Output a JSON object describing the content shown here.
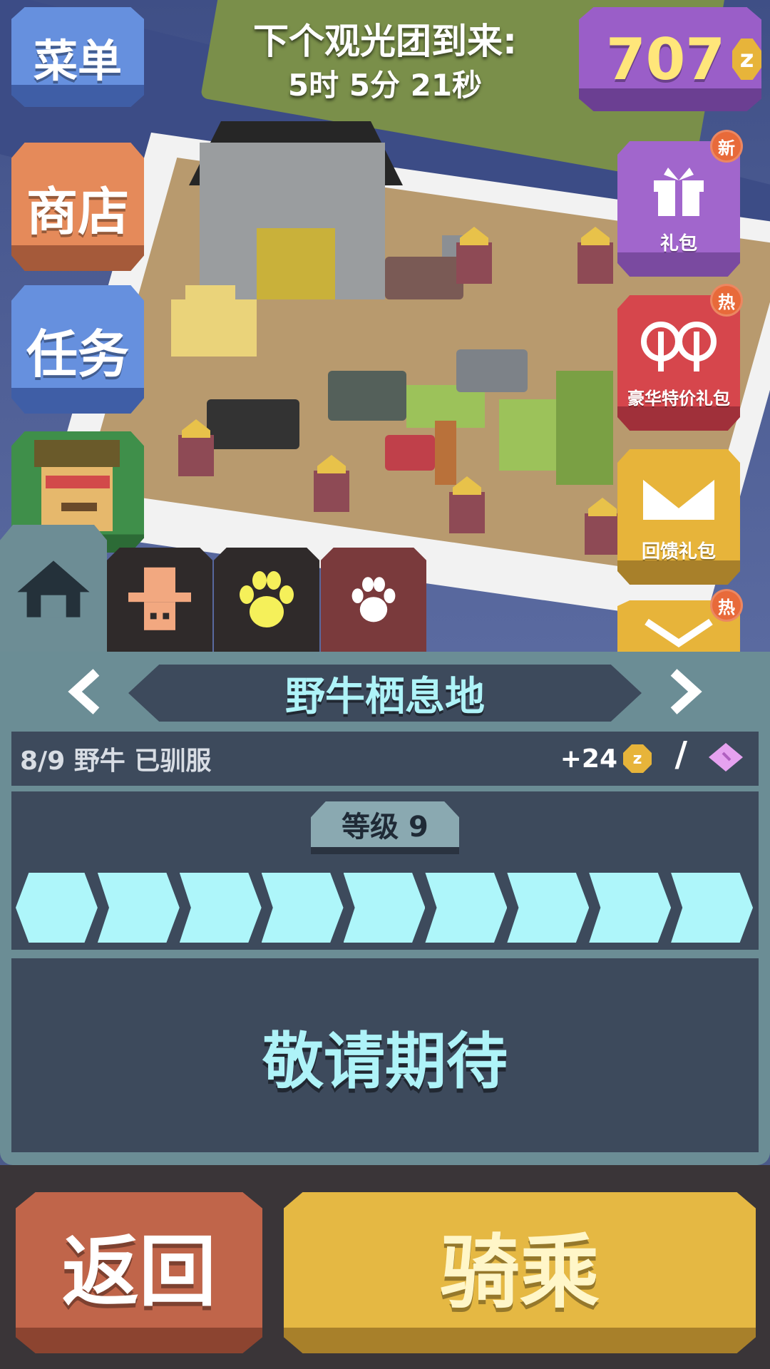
{
  "hud": {
    "menu_label": "菜单",
    "shop_label": "商店",
    "task_label": "任务",
    "next_tour_title": "下个观光团到来:",
    "next_tour_time": "5时 5分 21秒",
    "coins": "707",
    "coin_icon": "coin-icon",
    "coin_symbol": "z"
  },
  "side_packs": [
    {
      "label": "礼包",
      "badge": "新",
      "icon": "gift-icon"
    },
    {
      "label": "豪华特价礼包",
      "badge": "热",
      "icon": "lantern-icon"
    },
    {
      "label": "回馈礼包",
      "icon": "envelope-icon"
    },
    {
      "badge": "热",
      "icon": "heart-icon"
    }
  ],
  "tabs": [
    {
      "icon": "home-icon"
    },
    {
      "icon": "cowboy-hat-icon"
    },
    {
      "icon": "paw-icon",
      "color": "#f5f05a"
    },
    {
      "icon": "paw-icon",
      "color": "#ffffff"
    }
  ],
  "habitat": {
    "name": "野牛栖息地",
    "tamed_text": "8/9 野牛 已驯服",
    "reward": "+24",
    "slash": "/",
    "ticket_icon": "ticket-icon"
  },
  "level": {
    "label": "等级 9",
    "segments_filled": 9,
    "segments_total": 9
  },
  "coming_soon": "敬请期待",
  "buttons": {
    "back": "返回",
    "ride": "骑乘"
  },
  "colors": {
    "accent_cyan": "#aef6fa",
    "panel_dark": "#3d4a5c",
    "panel_teal": "#6b8d95",
    "coin_gold": "#e7b43a"
  }
}
